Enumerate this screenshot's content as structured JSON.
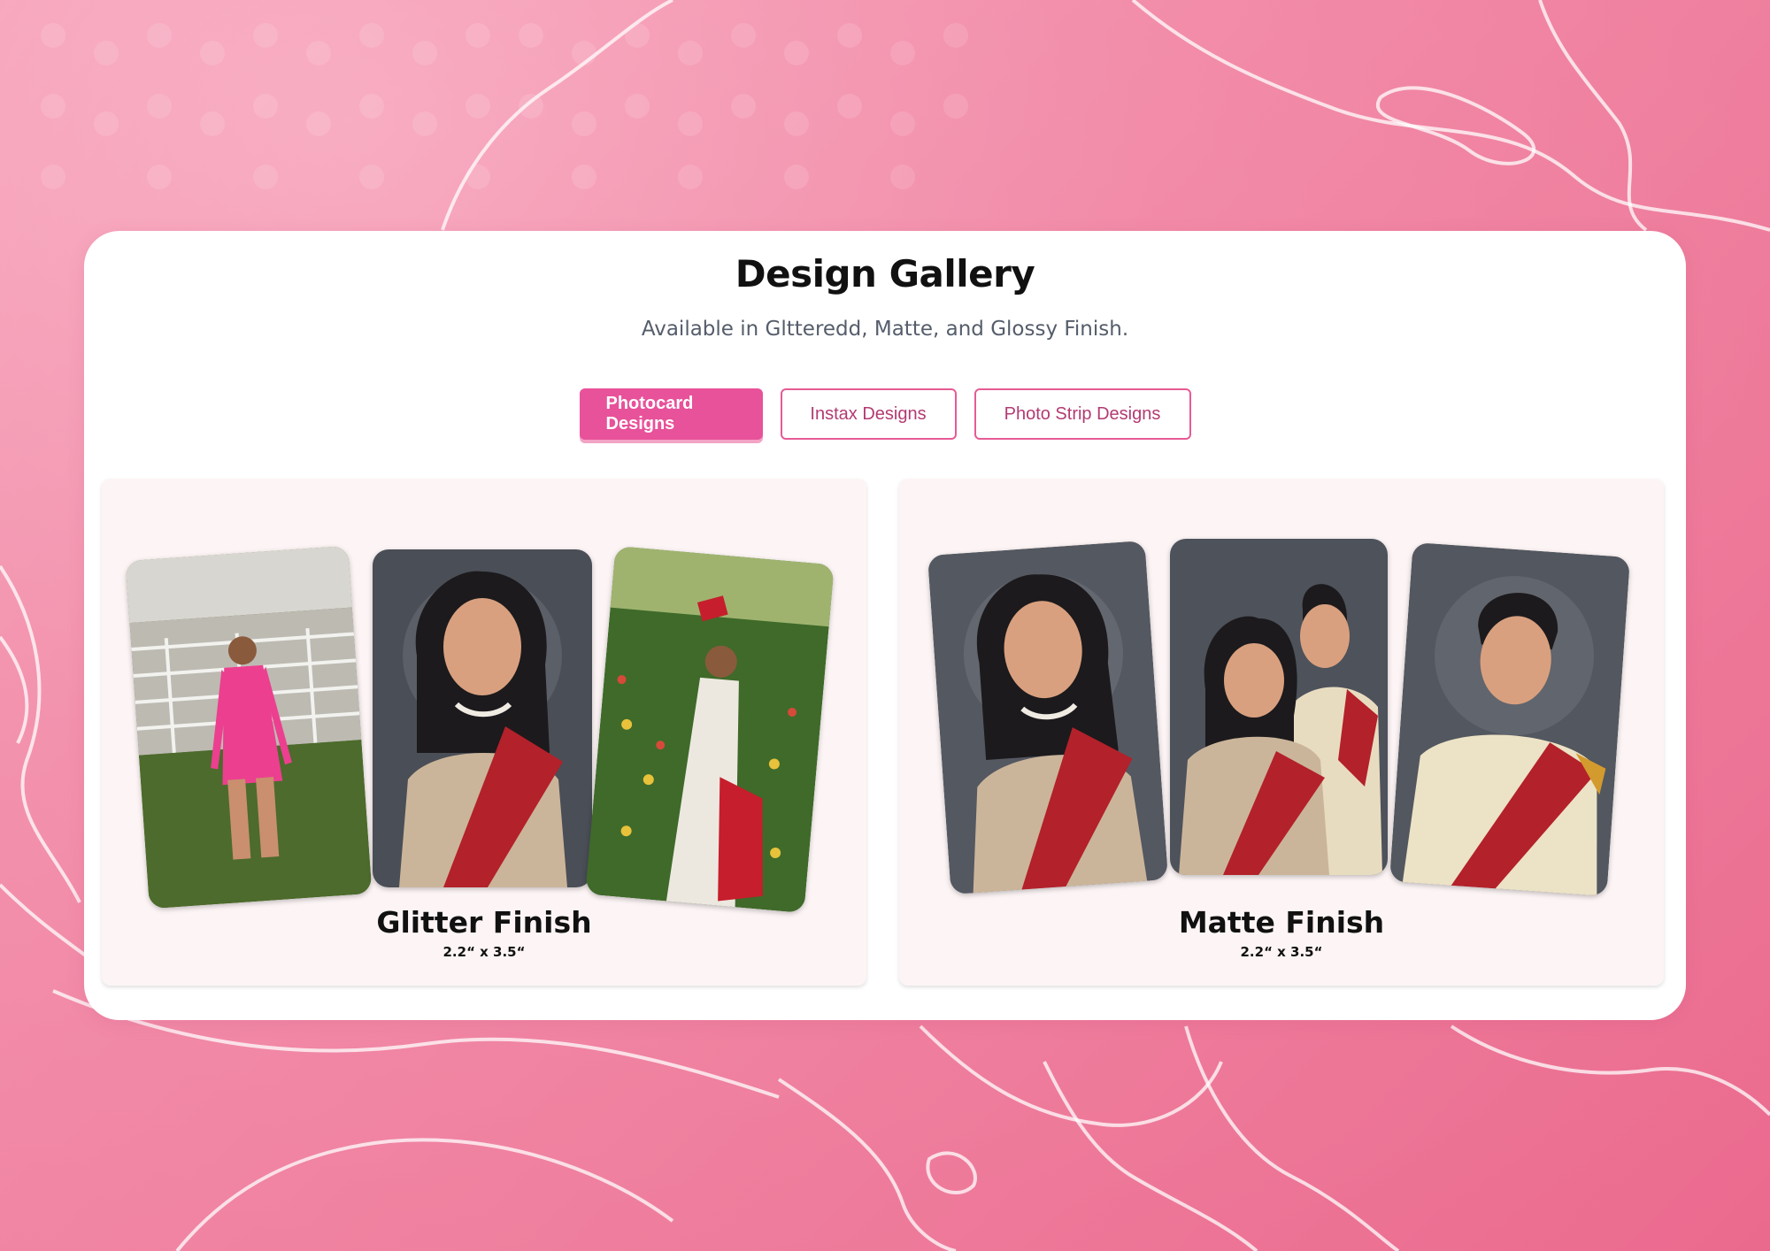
{
  "gallery": {
    "title": "Design Gallery",
    "subtitle": "Available in Gltteredd, Matte, and Glossy Finish."
  },
  "tabs": [
    {
      "label": "Photocard Designs",
      "active": true
    },
    {
      "label": "Instax Designs",
      "active": false
    },
    {
      "label": "Photo Strip Designs",
      "active": false
    }
  ],
  "cards": [
    {
      "title": "Glitter Finish",
      "size": "2.2“ x 3.5“"
    },
    {
      "title": "Matte Finish",
      "size": "2.2“ x 3.5“"
    }
  ],
  "colors": {
    "accent": "#e8529a",
    "tab_text": "#b33a72",
    "background": "#f7b8cb"
  }
}
